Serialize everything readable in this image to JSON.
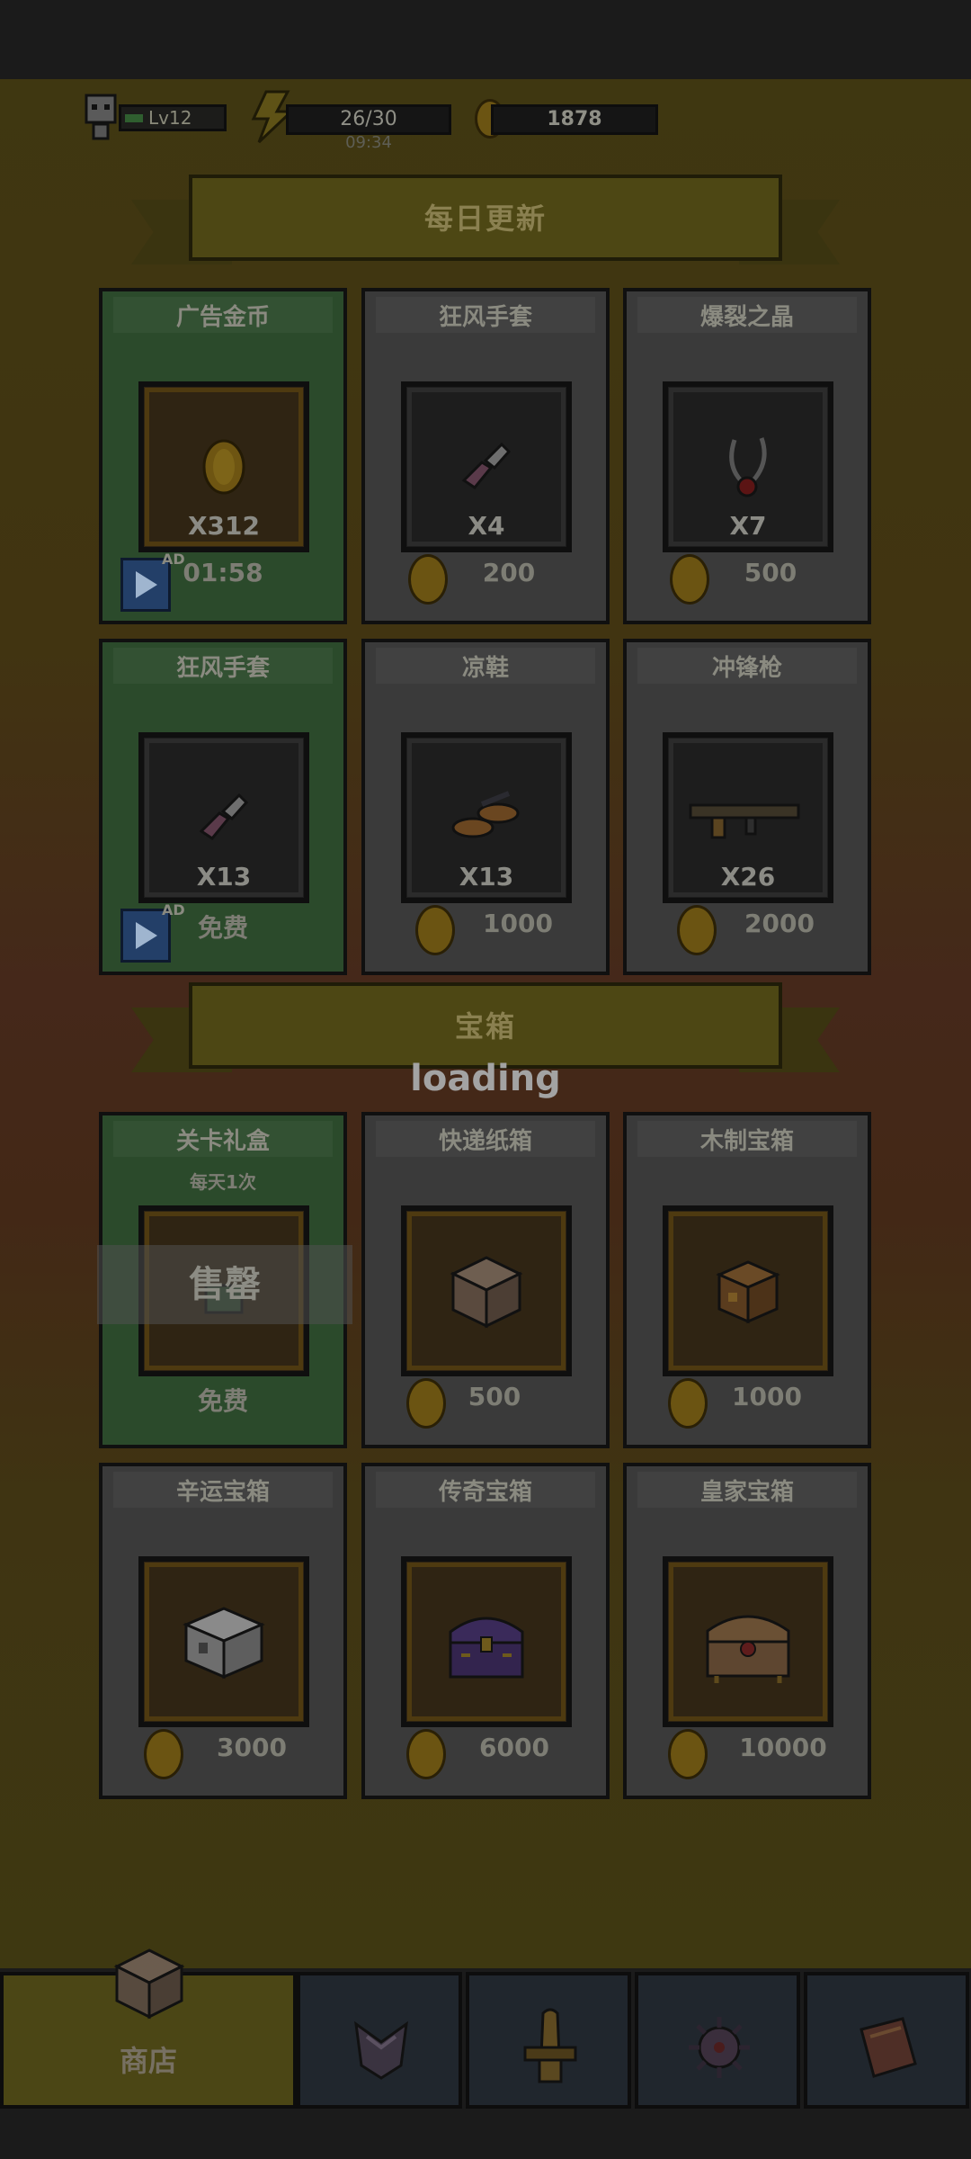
{
  "hud": {
    "level": "Lv12",
    "energy": "26/30",
    "energy_timer": "09:34",
    "gold": "1878"
  },
  "sections": {
    "daily": {
      "title": "每日更新"
    },
    "chests": {
      "title": "宝箱"
    }
  },
  "daily_items": [
    {
      "title": "广告金币",
      "qty": "X312",
      "price": "01:58",
      "style": "green",
      "ad": true,
      "ad_label": "AD",
      "icon": "coin-icon"
    },
    {
      "title": "狂风手套",
      "qty": "X4",
      "price": "200",
      "style": "gray",
      "ad": false,
      "icon": "gloves-icon"
    },
    {
      "title": "爆裂之晶",
      "qty": "X7",
      "price": "500",
      "style": "gray",
      "ad": false,
      "icon": "crystal-necklace-icon"
    },
    {
      "title": "狂风手套",
      "qty": "X13",
      "price": "免费",
      "style": "green",
      "ad": true,
      "ad_label": "AD",
      "icon": "gloves-icon"
    },
    {
      "title": "凉鞋",
      "qty": "X13",
      "price": "1000",
      "style": "gray",
      "ad": false,
      "icon": "sandals-icon"
    },
    {
      "title": "冲锋枪",
      "qty": "X26",
      "price": "2000",
      "style": "gray",
      "ad": false,
      "icon": "smg-icon"
    }
  ],
  "chest_items": [
    {
      "title": "关卡礼盒",
      "subtitle": "每天1次",
      "price": "免费",
      "style": "green",
      "sold_out": "售罄",
      "icon": "gift-box-icon"
    },
    {
      "title": "快递纸箱",
      "price": "500",
      "style": "gray",
      "icon": "cardboard-box-icon"
    },
    {
      "title": "木制宝箱",
      "price": "1000",
      "style": "gray",
      "icon": "wooden-chest-icon"
    },
    {
      "title": "辛运宝箱",
      "price": "3000",
      "style": "gray",
      "icon": "silver-chest-icon"
    },
    {
      "title": "传奇宝箱",
      "price": "6000",
      "style": "gray",
      "icon": "legendary-chest-icon"
    },
    {
      "title": "皇家宝箱",
      "price": "10000",
      "style": "gray",
      "icon": "royal-chest-icon"
    }
  ],
  "loading_text": "loading",
  "nav": {
    "shop_label": "商店",
    "tabs": [
      "armor-icon",
      "bullet-icon",
      "spiked-bomb-icon",
      "book-icon"
    ]
  }
}
